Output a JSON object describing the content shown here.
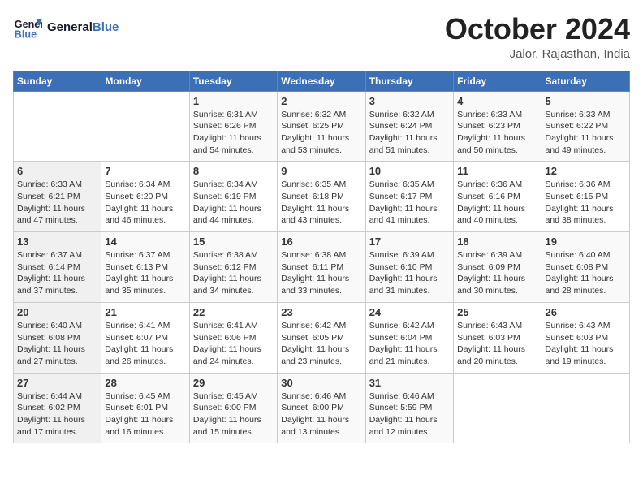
{
  "logo": {
    "name_part1": "General",
    "name_part2": "Blue"
  },
  "header": {
    "month_year": "October 2024",
    "location": "Jalor, Rajasthan, India"
  },
  "days_of_week": [
    "Sunday",
    "Monday",
    "Tuesday",
    "Wednesday",
    "Thursday",
    "Friday",
    "Saturday"
  ],
  "weeks": [
    [
      {
        "day": "",
        "detail": ""
      },
      {
        "day": "",
        "detail": ""
      },
      {
        "day": "1",
        "detail": "Sunrise: 6:31 AM\nSunset: 6:26 PM\nDaylight: 11 hours and 54 minutes."
      },
      {
        "day": "2",
        "detail": "Sunrise: 6:32 AM\nSunset: 6:25 PM\nDaylight: 11 hours and 53 minutes."
      },
      {
        "day": "3",
        "detail": "Sunrise: 6:32 AM\nSunset: 6:24 PM\nDaylight: 11 hours and 51 minutes."
      },
      {
        "day": "4",
        "detail": "Sunrise: 6:33 AM\nSunset: 6:23 PM\nDaylight: 11 hours and 50 minutes."
      },
      {
        "day": "5",
        "detail": "Sunrise: 6:33 AM\nSunset: 6:22 PM\nDaylight: 11 hours and 49 minutes."
      }
    ],
    [
      {
        "day": "6",
        "detail": "Sunrise: 6:33 AM\nSunset: 6:21 PM\nDaylight: 11 hours and 47 minutes."
      },
      {
        "day": "7",
        "detail": "Sunrise: 6:34 AM\nSunset: 6:20 PM\nDaylight: 11 hours and 46 minutes."
      },
      {
        "day": "8",
        "detail": "Sunrise: 6:34 AM\nSunset: 6:19 PM\nDaylight: 11 hours and 44 minutes."
      },
      {
        "day": "9",
        "detail": "Sunrise: 6:35 AM\nSunset: 6:18 PM\nDaylight: 11 hours and 43 minutes."
      },
      {
        "day": "10",
        "detail": "Sunrise: 6:35 AM\nSunset: 6:17 PM\nDaylight: 11 hours and 41 minutes."
      },
      {
        "day": "11",
        "detail": "Sunrise: 6:36 AM\nSunset: 6:16 PM\nDaylight: 11 hours and 40 minutes."
      },
      {
        "day": "12",
        "detail": "Sunrise: 6:36 AM\nSunset: 6:15 PM\nDaylight: 11 hours and 38 minutes."
      }
    ],
    [
      {
        "day": "13",
        "detail": "Sunrise: 6:37 AM\nSunset: 6:14 PM\nDaylight: 11 hours and 37 minutes."
      },
      {
        "day": "14",
        "detail": "Sunrise: 6:37 AM\nSunset: 6:13 PM\nDaylight: 11 hours and 35 minutes."
      },
      {
        "day": "15",
        "detail": "Sunrise: 6:38 AM\nSunset: 6:12 PM\nDaylight: 11 hours and 34 minutes."
      },
      {
        "day": "16",
        "detail": "Sunrise: 6:38 AM\nSunset: 6:11 PM\nDaylight: 11 hours and 33 minutes."
      },
      {
        "day": "17",
        "detail": "Sunrise: 6:39 AM\nSunset: 6:10 PM\nDaylight: 11 hours and 31 minutes."
      },
      {
        "day": "18",
        "detail": "Sunrise: 6:39 AM\nSunset: 6:09 PM\nDaylight: 11 hours and 30 minutes."
      },
      {
        "day": "19",
        "detail": "Sunrise: 6:40 AM\nSunset: 6:08 PM\nDaylight: 11 hours and 28 minutes."
      }
    ],
    [
      {
        "day": "20",
        "detail": "Sunrise: 6:40 AM\nSunset: 6:08 PM\nDaylight: 11 hours and 27 minutes."
      },
      {
        "day": "21",
        "detail": "Sunrise: 6:41 AM\nSunset: 6:07 PM\nDaylight: 11 hours and 26 minutes."
      },
      {
        "day": "22",
        "detail": "Sunrise: 6:41 AM\nSunset: 6:06 PM\nDaylight: 11 hours and 24 minutes."
      },
      {
        "day": "23",
        "detail": "Sunrise: 6:42 AM\nSunset: 6:05 PM\nDaylight: 11 hours and 23 minutes."
      },
      {
        "day": "24",
        "detail": "Sunrise: 6:42 AM\nSunset: 6:04 PM\nDaylight: 11 hours and 21 minutes."
      },
      {
        "day": "25",
        "detail": "Sunrise: 6:43 AM\nSunset: 6:03 PM\nDaylight: 11 hours and 20 minutes."
      },
      {
        "day": "26",
        "detail": "Sunrise: 6:43 AM\nSunset: 6:03 PM\nDaylight: 11 hours and 19 minutes."
      }
    ],
    [
      {
        "day": "27",
        "detail": "Sunrise: 6:44 AM\nSunset: 6:02 PM\nDaylight: 11 hours and 17 minutes."
      },
      {
        "day": "28",
        "detail": "Sunrise: 6:45 AM\nSunset: 6:01 PM\nDaylight: 11 hours and 16 minutes."
      },
      {
        "day": "29",
        "detail": "Sunrise: 6:45 AM\nSunset: 6:00 PM\nDaylight: 11 hours and 15 minutes."
      },
      {
        "day": "30",
        "detail": "Sunrise: 6:46 AM\nSunset: 6:00 PM\nDaylight: 11 hours and 13 minutes."
      },
      {
        "day": "31",
        "detail": "Sunrise: 6:46 AM\nSunset: 5:59 PM\nDaylight: 11 hours and 12 minutes."
      },
      {
        "day": "",
        "detail": ""
      },
      {
        "day": "",
        "detail": ""
      }
    ]
  ]
}
